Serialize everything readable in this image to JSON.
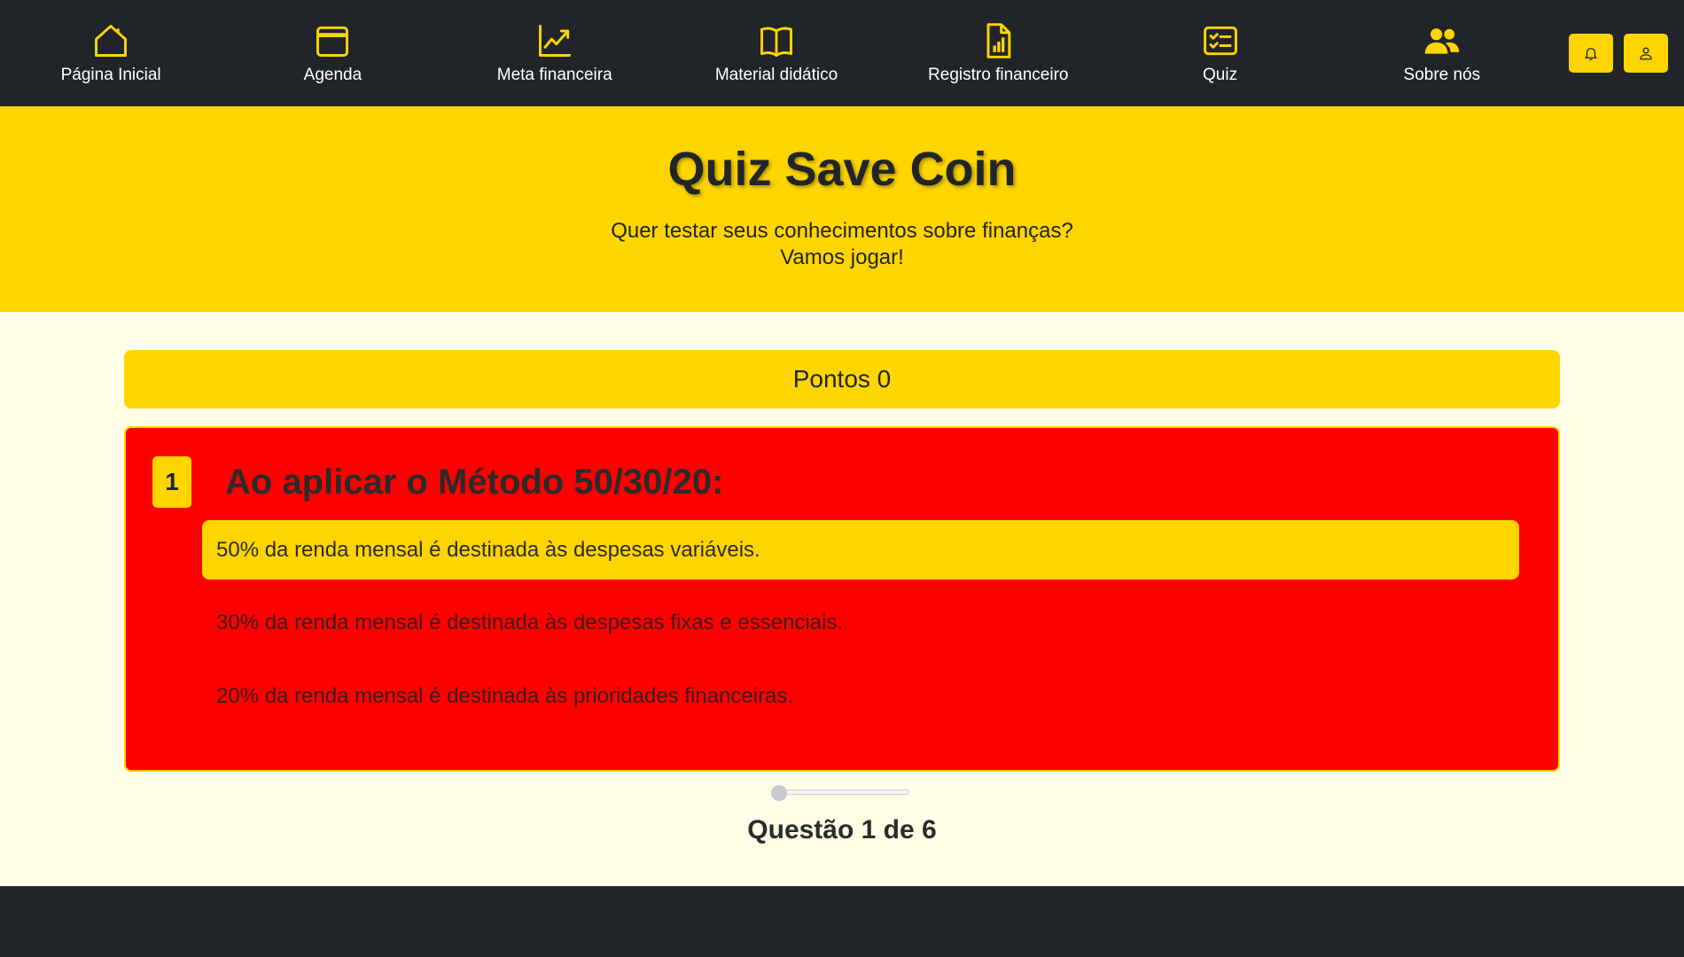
{
  "nav": {
    "items": [
      {
        "label": "Página Inicial",
        "icon": "home-icon"
      },
      {
        "label": "Agenda",
        "icon": "calendar-icon"
      },
      {
        "label": "Meta financeira",
        "icon": "chart-line-icon"
      },
      {
        "label": "Material didático",
        "icon": "book-icon"
      },
      {
        "label": "Registro financeiro",
        "icon": "file-chart-icon"
      },
      {
        "label": "Quiz",
        "icon": "checklist-icon"
      },
      {
        "label": "Sobre nós",
        "icon": "people-icon"
      }
    ],
    "actions": [
      {
        "icon": "bell-icon"
      },
      {
        "icon": "user-icon"
      }
    ]
  },
  "hero": {
    "title": "Quiz Save Coin",
    "subtitle_line1": "Quer testar seus conhecimentos sobre finanças?",
    "subtitle_line2": "Vamos jogar!"
  },
  "quiz": {
    "score_text": "Pontos 0",
    "question_number": "1",
    "question_title": "Ao aplicar o Método 50/30/20:",
    "answers": [
      "50% da renda mensal é destinada às despesas variáveis.",
      "30% da renda mensal é destinada às despesas fixas e essenciais.",
      "20% da renda mensal é destinada às prioridades financeiras."
    ],
    "selected_answer": 0,
    "progress_fraction": 0.0,
    "counter_text": "Questão 1 de 6"
  },
  "colors": {
    "accent": "#ffd500",
    "dark": "#212529",
    "card": "#ff0000",
    "page_bg": "#fffde6"
  }
}
